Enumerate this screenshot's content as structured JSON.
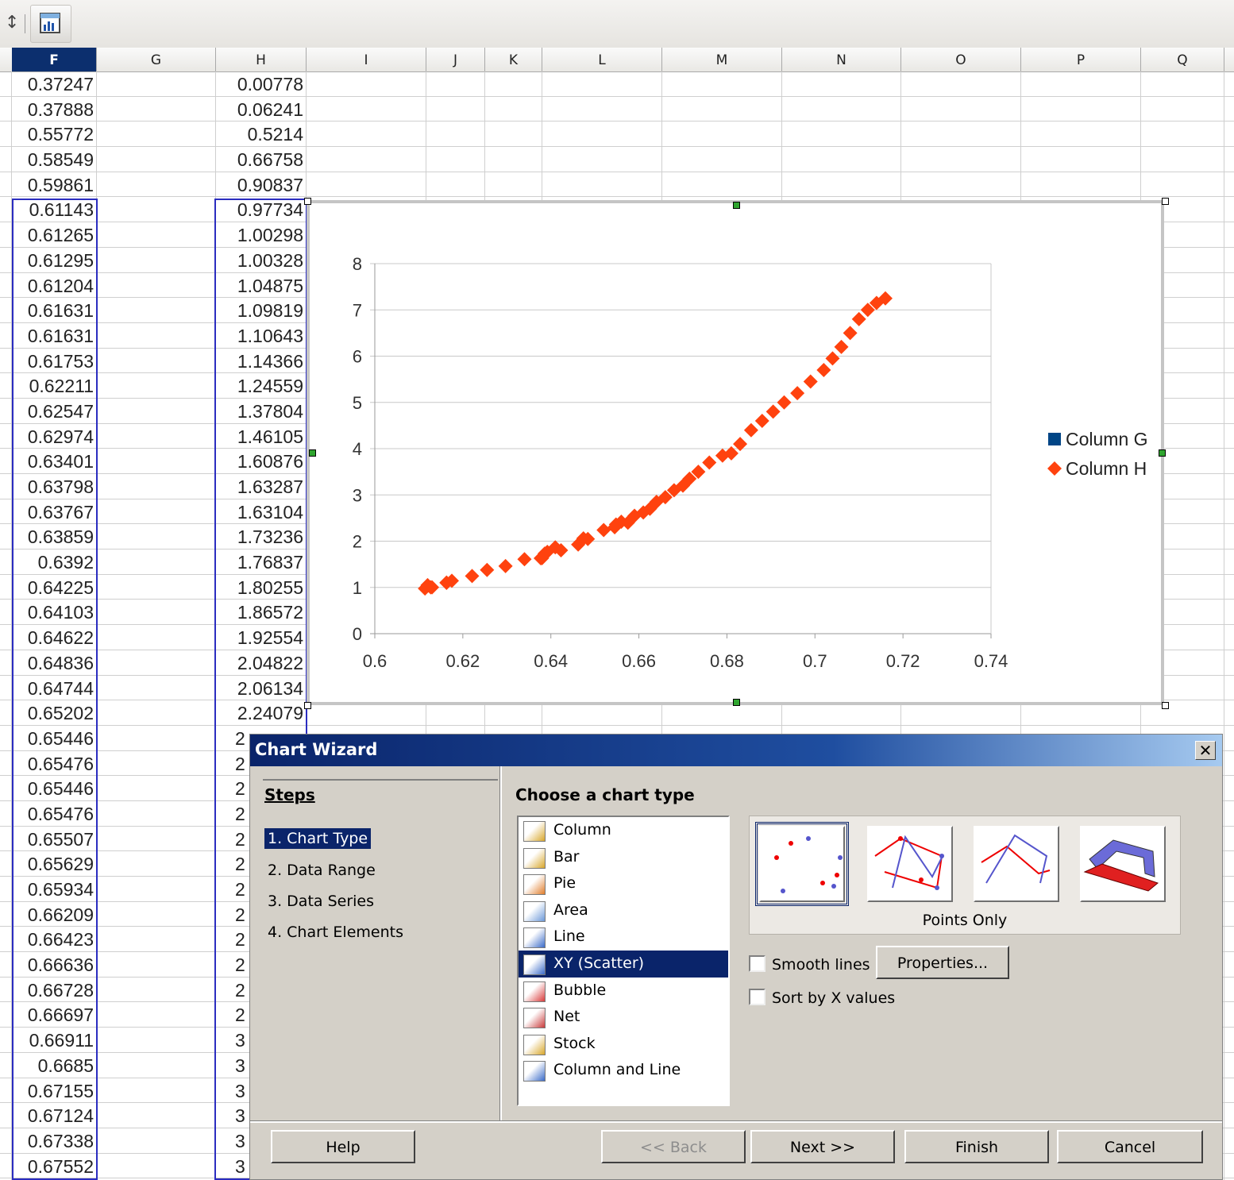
{
  "sheet": {
    "columns": [
      "F",
      "G",
      "H",
      "I",
      "J",
      "K",
      "L",
      "M",
      "N",
      "O",
      "P",
      "Q"
    ],
    "selected_column": "F",
    "col_F": [
      "0.37247",
      "0.37888",
      "0.55772",
      "0.58549",
      "0.59861",
      "0.61143",
      "0.61265",
      "0.61295",
      "0.61204",
      "0.61631",
      "0.61631",
      "0.61753",
      "0.62211",
      "0.62547",
      "0.62974",
      "0.63401",
      "0.63798",
      "0.63767",
      "0.63859",
      "0.6392",
      "0.64225",
      "0.64103",
      "0.64622",
      "0.64836",
      "0.64744",
      "0.65202",
      "0.65446",
      "0.65476",
      "0.65446",
      "0.65476",
      "0.65507",
      "0.65629",
      "0.65934",
      "0.66209",
      "0.66423",
      "0.66636",
      "0.66728",
      "0.66697",
      "0.66911",
      "0.6685",
      "0.67155",
      "0.67124",
      "0.67338",
      "0.67552"
    ],
    "col_H": [
      "0.00778",
      "0.06241",
      "0.5214",
      "0.66758",
      "0.90837",
      "0.97734",
      "1.00298",
      "1.00328",
      "1.04875",
      "1.09819",
      "1.10643",
      "1.14366",
      "1.24559",
      "1.37804",
      "1.46105",
      "1.60876",
      "1.63287",
      "1.63104",
      "1.73236",
      "1.76837",
      "1.80255",
      "1.86572",
      "1.92554",
      "2.04822",
      "2.06134",
      "2.24079",
      "2",
      "2",
      "2",
      "2",
      "2",
      "2",
      "2",
      "2",
      "2",
      "2",
      "2",
      "2",
      "3",
      "3",
      "3",
      "3",
      "3",
      "3"
    ]
  },
  "chart_data": {
    "type": "scatter",
    "xlim": [
      0.6,
      0.74
    ],
    "ylim": [
      0,
      8
    ],
    "x_ticks": [
      "0.6",
      "0.62",
      "0.64",
      "0.66",
      "0.68",
      "0.7",
      "0.72",
      "0.74"
    ],
    "y_ticks": [
      "0",
      "1",
      "2",
      "3",
      "4",
      "5",
      "6",
      "7",
      "8"
    ],
    "grid": true,
    "legend_position": "right",
    "series": [
      {
        "name": "Column G",
        "color": "#004586",
        "marker": "square",
        "points": []
      },
      {
        "name": "Column H",
        "color": "#ff420e",
        "marker": "diamond",
        "points": [
          [
            0.6114,
            0.977
          ],
          [
            0.6127,
            1.003
          ],
          [
            0.613,
            1.003
          ],
          [
            0.612,
            1.049
          ],
          [
            0.6163,
            1.098
          ],
          [
            0.6163,
            1.106
          ],
          [
            0.6175,
            1.144
          ],
          [
            0.6221,
            1.246
          ],
          [
            0.6255,
            1.378
          ],
          [
            0.6297,
            1.461
          ],
          [
            0.634,
            1.609
          ],
          [
            0.638,
            1.633
          ],
          [
            0.6377,
            1.631
          ],
          [
            0.6386,
            1.732
          ],
          [
            0.6392,
            1.768
          ],
          [
            0.6423,
            1.803
          ],
          [
            0.641,
            1.866
          ],
          [
            0.6462,
            1.926
          ],
          [
            0.6484,
            2.048
          ],
          [
            0.6474,
            2.061
          ],
          [
            0.652,
            2.241
          ],
          [
            0.6545,
            2.3
          ],
          [
            0.6548,
            2.36
          ],
          [
            0.656,
            2.42
          ],
          [
            0.6575,
            2.4
          ],
          [
            0.659,
            2.55
          ],
          [
            0.661,
            2.62
          ],
          [
            0.6625,
            2.7
          ],
          [
            0.664,
            2.85
          ],
          [
            0.666,
            2.95
          ],
          [
            0.668,
            3.1
          ],
          [
            0.67,
            3.2
          ],
          [
            0.6715,
            3.35
          ],
          [
            0.6735,
            3.5
          ],
          [
            0.676,
            3.7
          ],
          [
            0.679,
            3.85
          ],
          [
            0.681,
            3.9
          ],
          [
            0.683,
            4.1
          ],
          [
            0.6855,
            4.4
          ],
          [
            0.688,
            4.6
          ],
          [
            0.6905,
            4.8
          ],
          [
            0.693,
            5.0
          ],
          [
            0.696,
            5.2
          ],
          [
            0.699,
            5.45
          ],
          [
            0.702,
            5.7
          ],
          [
            0.704,
            5.95
          ],
          [
            0.706,
            6.2
          ],
          [
            0.708,
            6.5
          ],
          [
            0.71,
            6.8
          ],
          [
            0.712,
            7.0
          ],
          [
            0.714,
            7.15
          ],
          [
            0.716,
            7.25
          ]
        ]
      }
    ]
  },
  "dialog": {
    "title": "Chart Wizard",
    "close": "✕",
    "steps_heading": "Steps",
    "steps": [
      "1. Chart Type",
      "2. Data Range",
      "3. Data Series",
      "4. Chart Elements"
    ],
    "choose_heading": "Choose a chart type",
    "chart_types": [
      "Column",
      "Bar",
      "Pie",
      "Area",
      "Line",
      "XY (Scatter)",
      "Bubble",
      "Net",
      "Stock",
      "Column and Line"
    ],
    "selected_type": "XY (Scatter)",
    "variant_caption": "Points Only",
    "smooth_lines": "Smooth lines",
    "sort_by_x": "Sort by X values",
    "properties": "Properties...",
    "buttons": {
      "help": "Help",
      "back": "<< Back",
      "next": "Next >>",
      "finish": "Finish",
      "cancel": "Cancel"
    }
  },
  "colors": {
    "selection": "#0a246a",
    "title_gradient_end": "#a6caf0",
    "series_h": "#ff420e",
    "series_g": "#004586"
  }
}
